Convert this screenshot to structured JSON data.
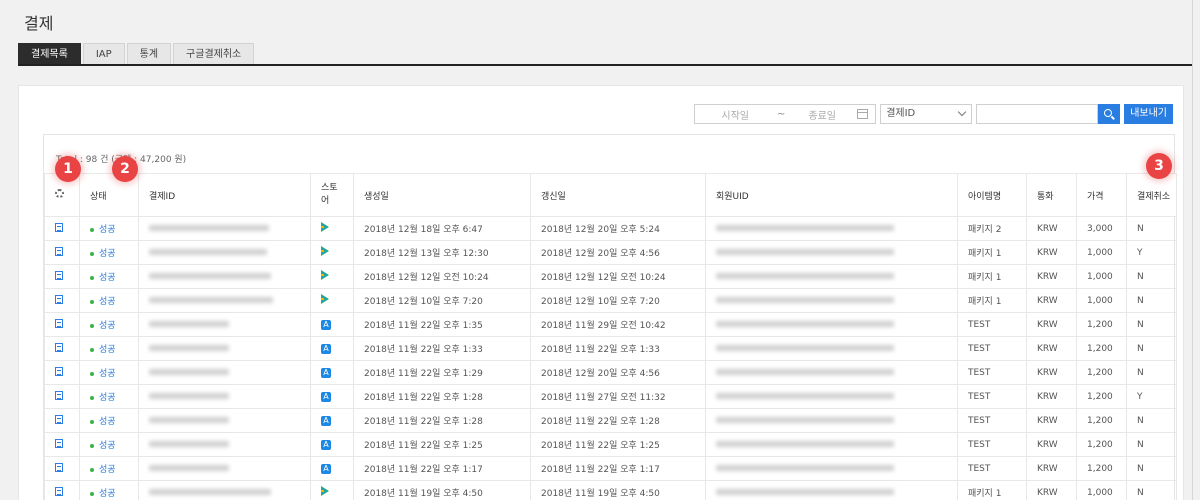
{
  "page": {
    "title": "결제"
  },
  "tabs": [
    {
      "label": "결제목록",
      "active": true
    },
    {
      "label": "IAP",
      "active": false
    },
    {
      "label": "통계",
      "active": false
    },
    {
      "label": "구글결제취소",
      "active": false
    }
  ],
  "toolbar": {
    "start_placeholder": "시작일",
    "separator": "~",
    "end_placeholder": "종료일",
    "select_value": "결제ID",
    "export_label": "내보내기"
  },
  "summary": {
    "total_text": "Total : 98 건 (금액 : 47,200 원)"
  },
  "table": {
    "headers": {
      "status": "상태",
      "payment_id": "결제ID",
      "store": "스토\n어",
      "created": "생성일",
      "updated": "갱신일",
      "member_uid": "회원UID",
      "item": "아이템명",
      "currency": "통화",
      "price": "가격",
      "cancel": "결제취소"
    },
    "rows": [
      {
        "status": "성공",
        "store": "google-play",
        "created": "2018년 12월 18일 오후 6:47",
        "updated": "2018년 12월 20일 오후 5:24",
        "item": "패키지 2",
        "currency": "KRW",
        "price": "3,000",
        "cancel": "N"
      },
      {
        "status": "성공",
        "store": "google-play",
        "created": "2018년 12월 13일 오후 12:30",
        "updated": "2018년 12월 20일 오후 4:56",
        "item": "패키지 1",
        "currency": "KRW",
        "price": "1,000",
        "cancel": "Y"
      },
      {
        "status": "성공",
        "store": "google-play",
        "created": "2018년 12월 12일 오전 10:24",
        "updated": "2018년 12월 12일 오전 10:24",
        "item": "패키지 1",
        "currency": "KRW",
        "price": "1,000",
        "cancel": "N"
      },
      {
        "status": "성공",
        "store": "google-play",
        "created": "2018년 12월 10일 오후 7:20",
        "updated": "2018년 12월 10일 오후 7:20",
        "item": "패키지 1",
        "currency": "KRW",
        "price": "1,000",
        "cancel": "N"
      },
      {
        "status": "성공",
        "store": "app-store",
        "created": "2018년 11월 22일 오후 1:35",
        "updated": "2018년 11월 29일 오전 10:42",
        "item": "TEST",
        "currency": "KRW",
        "price": "1,200",
        "cancel": "N"
      },
      {
        "status": "성공",
        "store": "app-store",
        "created": "2018년 11월 22일 오후 1:33",
        "updated": "2018년 11월 22일 오후 1:33",
        "item": "TEST",
        "currency": "KRW",
        "price": "1,200",
        "cancel": "N"
      },
      {
        "status": "성공",
        "store": "app-store",
        "created": "2018년 11월 22일 오후 1:29",
        "updated": "2018년 12월 20일 오후 4:56",
        "item": "TEST",
        "currency": "KRW",
        "price": "1,200",
        "cancel": "N"
      },
      {
        "status": "성공",
        "store": "app-store",
        "created": "2018년 11월 22일 오후 1:28",
        "updated": "2018년 11월 27일 오전 11:32",
        "item": "TEST",
        "currency": "KRW",
        "price": "1,200",
        "cancel": "Y"
      },
      {
        "status": "성공",
        "store": "app-store",
        "created": "2018년 11월 22일 오후 1:28",
        "updated": "2018년 11월 22일 오후 1:28",
        "item": "TEST",
        "currency": "KRW",
        "price": "1,200",
        "cancel": "N"
      },
      {
        "status": "성공",
        "store": "app-store",
        "created": "2018년 11월 22일 오후 1:25",
        "updated": "2018년 11월 22일 오후 1:25",
        "item": "TEST",
        "currency": "KRW",
        "price": "1,200",
        "cancel": "N"
      },
      {
        "status": "성공",
        "store": "app-store",
        "created": "2018년 11월 22일 오후 1:17",
        "updated": "2018년 11월 22일 오후 1:17",
        "item": "TEST",
        "currency": "KRW",
        "price": "1,200",
        "cancel": "N"
      },
      {
        "status": "성공",
        "store": "google-play",
        "created": "2018년 11월 19일 오후 4:50",
        "updated": "2018년 11월 19일 오후 4:50",
        "item": "패키지 1",
        "currency": "KRW",
        "price": "1,000",
        "cancel": "N"
      }
    ]
  },
  "callouts": [
    "1",
    "2",
    "3"
  ],
  "colors": {
    "accent": "#2a7de1",
    "success_dot": "#3db24b",
    "callout": "#e94343",
    "tab_active": "#2c2c2c"
  }
}
